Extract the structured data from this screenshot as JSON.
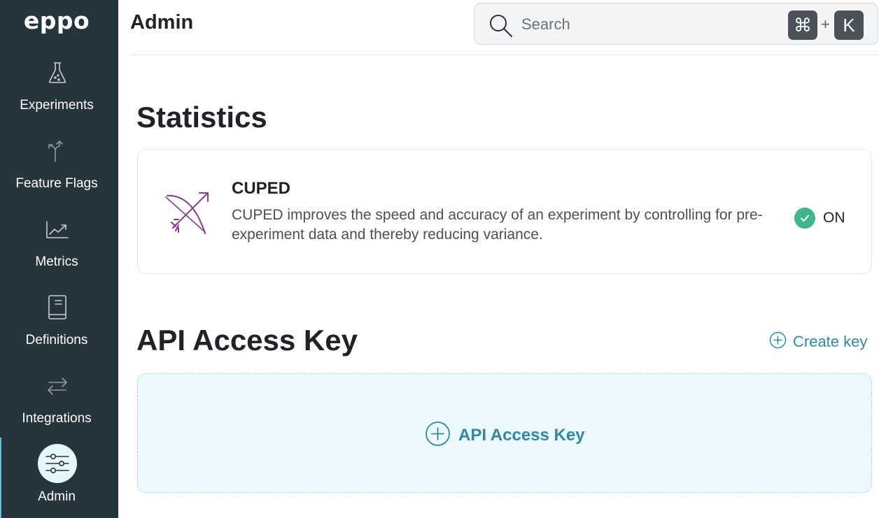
{
  "app": {
    "logo": "eppo"
  },
  "sidebar": {
    "items": [
      {
        "label": "Experiments",
        "icon": "flask-icon"
      },
      {
        "label": "Feature Flags",
        "icon": "branch-arrows-icon"
      },
      {
        "label": "Metrics",
        "icon": "trend-chart-icon"
      },
      {
        "label": "Definitions",
        "icon": "book-icon"
      },
      {
        "label": "Integrations",
        "icon": "swap-arrows-icon"
      },
      {
        "label": "Admin",
        "icon": "sliders-icon",
        "active": true
      }
    ]
  },
  "header": {
    "title": "Admin",
    "search": {
      "placeholder": "Search",
      "value": "",
      "shortcut_cmd": "⌘",
      "shortcut_plus": "+",
      "shortcut_key": "K"
    }
  },
  "statistics": {
    "title": "Statistics",
    "cuped": {
      "name": "CUPED",
      "description": "CUPED improves the speed and accuracy of an experiment by controlling for pre-experiment data and thereby reducing variance.",
      "status": "ON",
      "icon": "bow-and-arrow-icon"
    }
  },
  "api_access": {
    "title": "API Access Key",
    "create_label": "Create key",
    "empty_label": "API Access Key"
  },
  "colors": {
    "sidebar_bg": "#26353b",
    "accent": "#2e8aa3",
    "status_on": "#3fb68b",
    "cuped_icon": "#8a3a8c",
    "empty_bg": "#edf8fc"
  }
}
